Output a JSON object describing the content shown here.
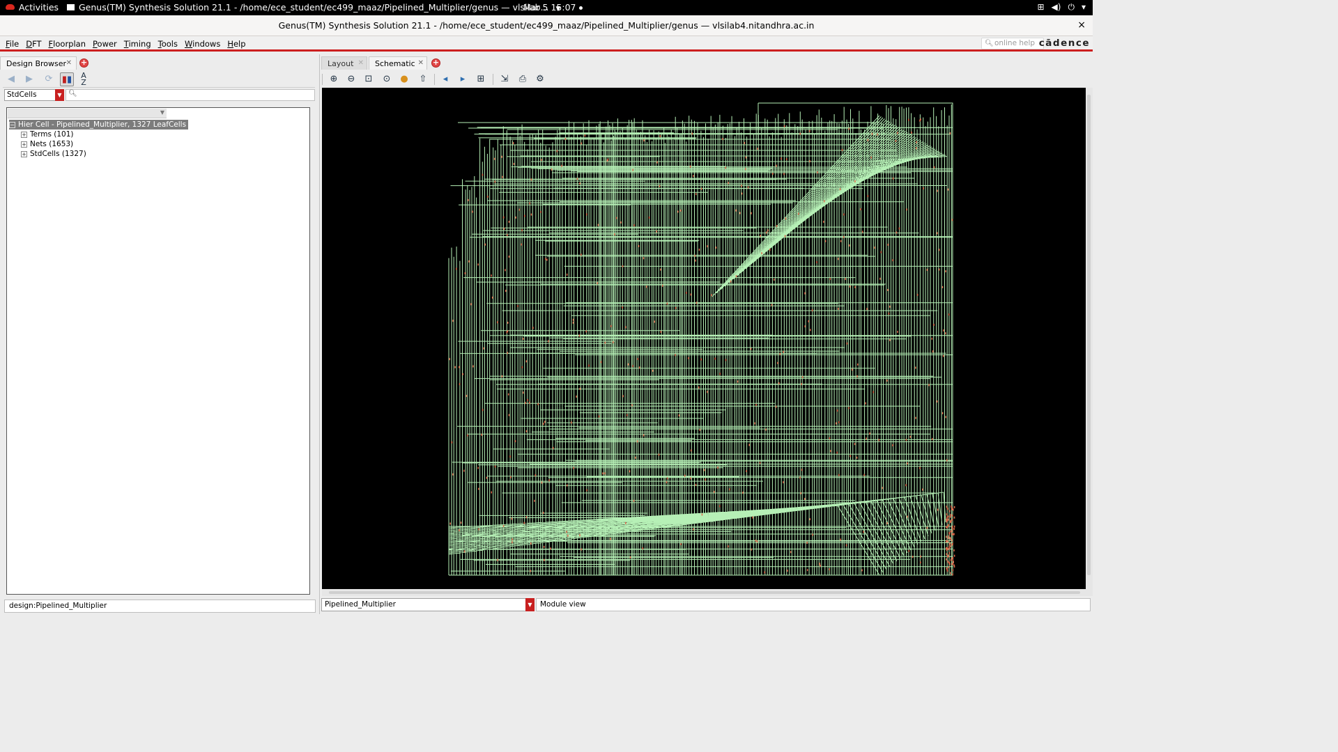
{
  "topbar": {
    "activities": "Activities",
    "app_title": "Genus(TM) Synthesis Solution 21.1 - /home/ece_student/ec499_maaz/Pipelined_Multiplier/genus — vlsilab...",
    "clock": "Mar 5  15:07"
  },
  "window": {
    "title": "Genus(TM) Synthesis Solution 21.1 - /home/ece_student/ec499_maaz/Pipelined_Multiplier/genus — vlsilab4.nitandhra.ac.in",
    "close": "×"
  },
  "menubar": {
    "items": [
      "File",
      "DFT",
      "Floorplan",
      "Power",
      "Timing",
      "Tools",
      "Windows",
      "Help"
    ],
    "help_placeholder": "online help",
    "brand": "cādence"
  },
  "left": {
    "tab_label": "Design Browser",
    "filter_value": "StdCells",
    "tree": {
      "root": "Hier Cell - Pipelined_Multiplier, 1327 LeafCells",
      "children": [
        "Terms (101)",
        "Nets (1653)",
        "StdCells (1327)"
      ]
    },
    "status": "design:Pipelined_Multiplier"
  },
  "right": {
    "tabs": [
      "Layout",
      "Schematic"
    ],
    "active_tab": "Schematic",
    "module_select": "Pipelined_Multiplier",
    "view_mode": "Module view"
  },
  "colors": {
    "wire": "#b6f0b6",
    "pin": "#e06a4a",
    "canvas": "#000000",
    "accent": "#cc1f1f"
  }
}
